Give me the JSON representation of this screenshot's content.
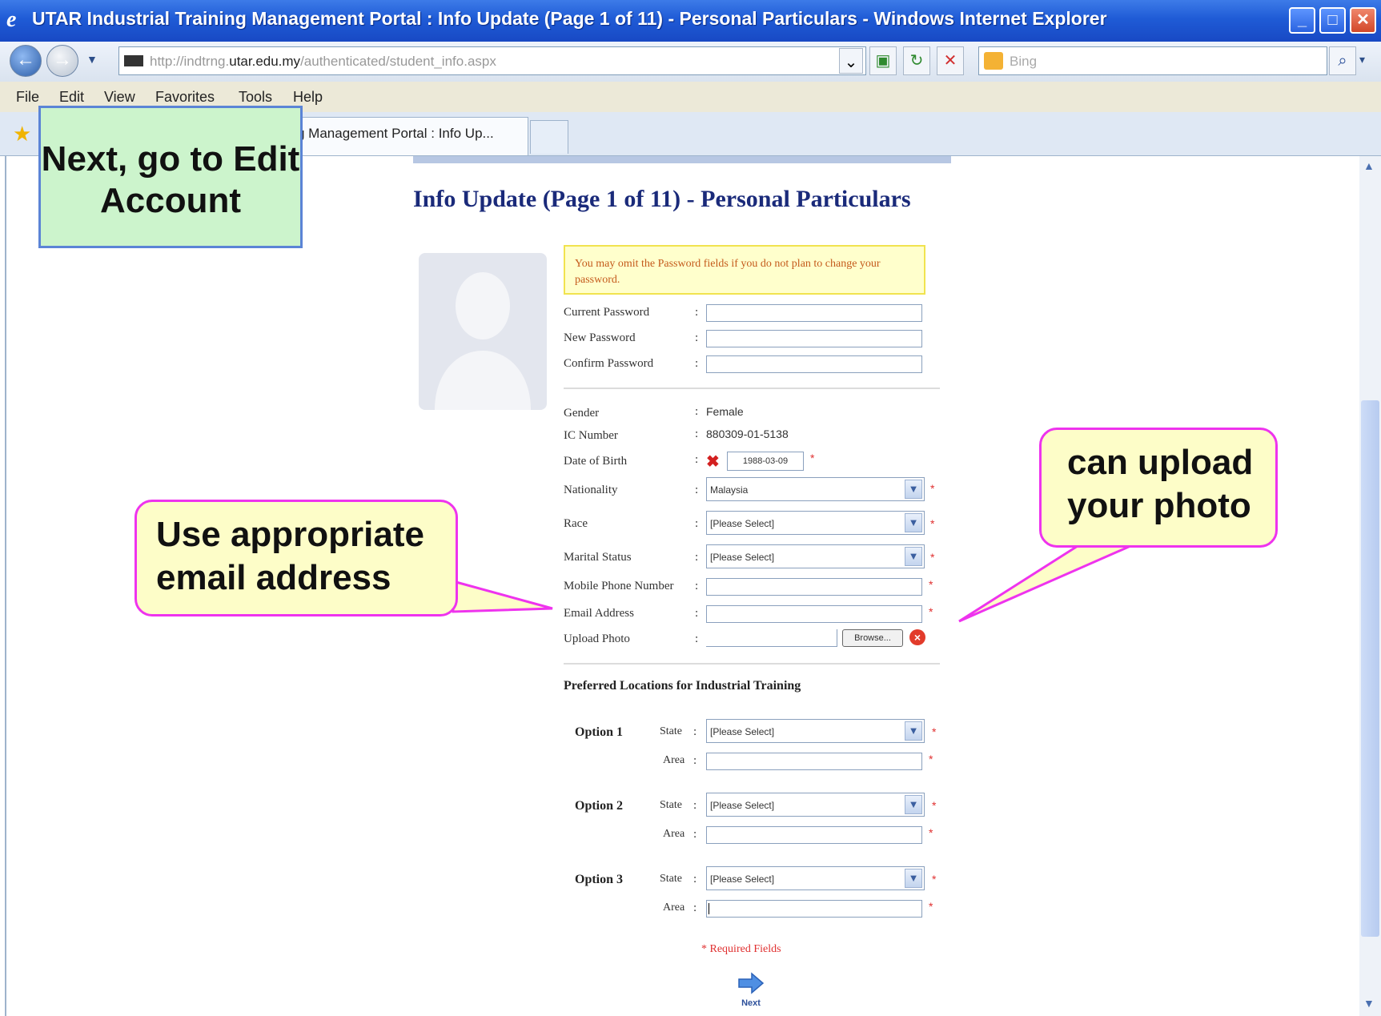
{
  "window": {
    "title": "UTAR Industrial Training Management Portal : Info Update (Page 1 of 11) - Personal Particulars - Windows Internet Explorer",
    "min": "_",
    "max": "□",
    "close": "✕"
  },
  "address_bar": {
    "url_prefix": "http://indtrng.",
    "url_domain": "utar.edu.my",
    "url_path": "/authenticated/student_info.aspx",
    "search_placeholder": "Bing"
  },
  "menu": [
    "File",
    "Edit",
    "View",
    "Favorites",
    "Tools",
    "Help"
  ],
  "tab": {
    "label": "g Management Portal : Info Up..."
  },
  "page": {
    "heading": "Info Update (Page 1 of 11) - Personal Particulars",
    "notice": "You may omit the Password fields if you do not plan to change your password.",
    "password_fields": [
      {
        "label": "Current Password"
      },
      {
        "label": "New Password"
      },
      {
        "label": "Confirm Password"
      }
    ],
    "personal": {
      "gender_label": "Gender",
      "gender_value": "Female",
      "ic_label": "IC Number",
      "ic_value": "880309-01-5138",
      "dob_label": "Date of Birth",
      "dob_value": "1988-03-09",
      "nationality_label": "Nationality",
      "nationality_value": "Malaysia",
      "race_label": "Race",
      "race_value": "[Please Select]",
      "marital_label": "Marital Status",
      "marital_value": "[Please Select]",
      "mobile_label": "Mobile Phone Number",
      "email_label": "Email Address",
      "photo_label": "Upload Photo",
      "browse_label": "Browse..."
    },
    "locations_heading": "Preferred Locations for Industrial Training",
    "options": [
      {
        "label": "Option 1",
        "state_label": "State",
        "state_value": "[Please Select]",
        "area_label": "Area"
      },
      {
        "label": "Option 2",
        "state_label": "State",
        "state_value": "[Please Select]",
        "area_label": "Area"
      },
      {
        "label": "Option 3",
        "state_label": "State",
        "state_value": "[Please Select]",
        "area_label": "Area"
      }
    ],
    "required_note": "* Required Fields",
    "next_label": "Next",
    "colon": ":",
    "asterisk": "*"
  },
  "callouts": {
    "edit_account": "Next, go to Edit Account",
    "email": "Use appropriate email address",
    "photo": "can upload your photo"
  },
  "colors": {
    "titlebar": "#1f5bd6",
    "heading": "#1a2a7a",
    "callout_border": "#ee33ee",
    "required": "#e03030"
  }
}
